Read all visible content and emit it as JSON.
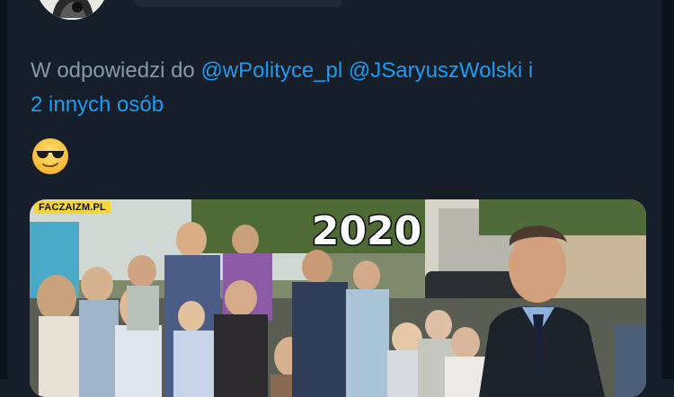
{
  "tweet": {
    "reply_prefix": "W odpowiedzi do",
    "mentions": [
      "@wPolityce_pl",
      "@JSaryuszWolski"
    ],
    "connector": "i",
    "others": "2 innych osób",
    "emoji": "😎",
    "emoji_name": "smiling-face-with-sunglasses-emoji"
  },
  "media": {
    "watermark": "FACZAIZM.PL",
    "year_caption": "2020"
  },
  "colors": {
    "background": "#151e29",
    "muted_text": "#8899a6",
    "link": "#1d9bf0"
  }
}
